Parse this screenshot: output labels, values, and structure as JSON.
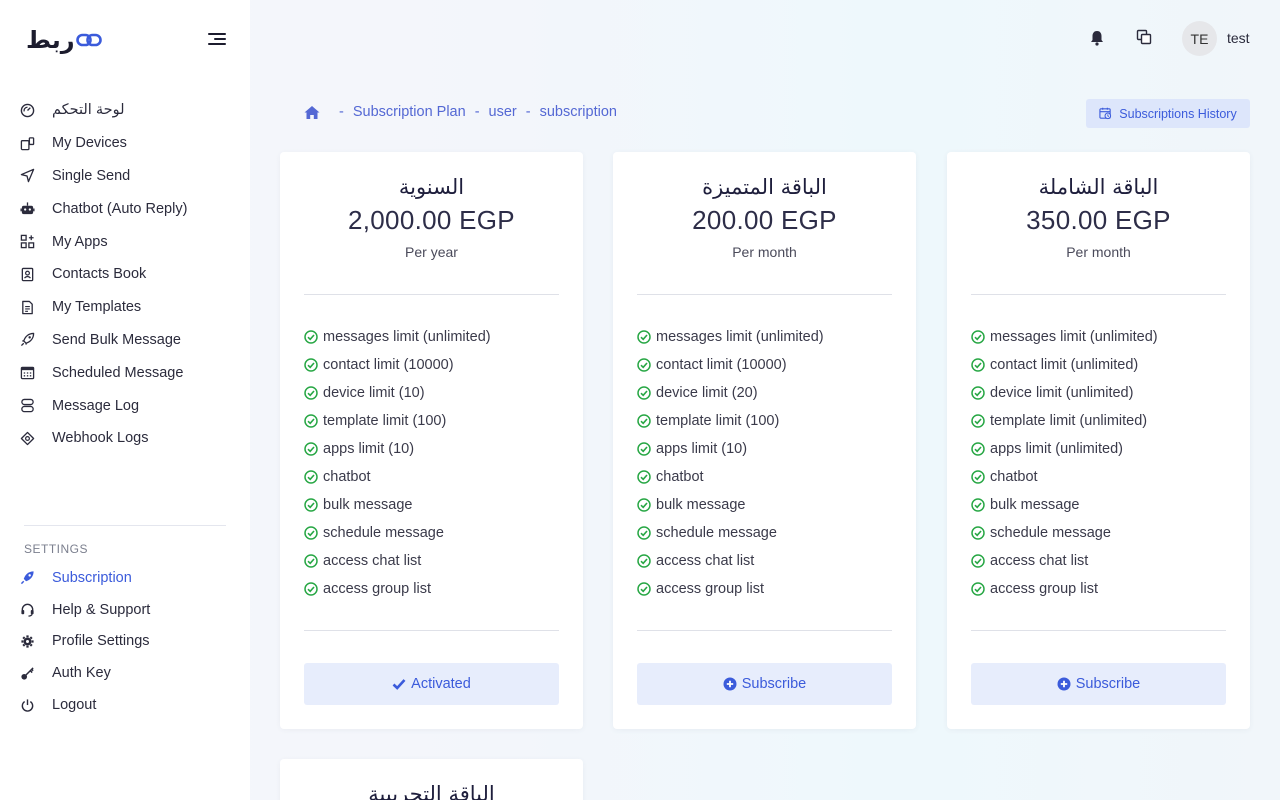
{
  "brand": {
    "logo_text": "ربط"
  },
  "sidebar": {
    "items": [
      {
        "label": "لوحة التحكم",
        "icon": "dashboard-icon"
      },
      {
        "label": "My Devices",
        "icon": "devices-icon"
      },
      {
        "label": "Single Send",
        "icon": "send-icon"
      },
      {
        "label": "Chatbot (Auto Reply)",
        "icon": "robot-icon"
      },
      {
        "label": "My Apps",
        "icon": "apps-icon"
      },
      {
        "label": "Contacts Book",
        "icon": "contacts-icon"
      },
      {
        "label": "My Templates",
        "icon": "templates-icon"
      },
      {
        "label": "Send Bulk Message",
        "icon": "rocket-icon"
      },
      {
        "label": "Scheduled Message",
        "icon": "calendar-icon"
      },
      {
        "label": "Message Log",
        "icon": "log-icon"
      },
      {
        "label": "Webhook Logs",
        "icon": "webhook-icon"
      }
    ],
    "settings_label": "SETTINGS",
    "settings_items": [
      {
        "label": "Subscription",
        "icon": "rocket-icon",
        "active": true
      },
      {
        "label": "Help & Support",
        "icon": "headset-icon"
      },
      {
        "label": "Profile Settings",
        "icon": "gear-icon"
      },
      {
        "label": "Auth Key",
        "icon": "key-icon"
      },
      {
        "label": "Logout",
        "icon": "power-icon"
      }
    ]
  },
  "header": {
    "avatar_initials": "TE",
    "username": "test"
  },
  "breadcrumb": {
    "items": [
      "Subscription Plan",
      "user",
      "subscription"
    ],
    "separator": "-"
  },
  "history_button": "Subscriptions History",
  "plans": [
    {
      "title": "السنوية",
      "price": "2,000.00 EGP",
      "period": "Per year",
      "features": [
        "messages limit (unlimited)",
        "contact limit (10000)",
        "device limit (10)",
        "template limit (100)",
        "apps limit (10)",
        "chatbot",
        "bulk message",
        "schedule message",
        "access chat list",
        "access group list"
      ],
      "button": "Activated",
      "button_icon": "check-icon"
    },
    {
      "title": "الباقة المتميزة",
      "price": "200.00 EGP",
      "period": "Per month",
      "features": [
        "messages limit (unlimited)",
        "contact limit (10000)",
        "device limit (20)",
        "template limit (100)",
        "apps limit (10)",
        "chatbot",
        "bulk message",
        "schedule message",
        "access chat list",
        "access group list"
      ],
      "button": "Subscribe",
      "button_icon": "plus-circle-icon"
    },
    {
      "title": "الباقة الشاملة",
      "price": "350.00 EGP",
      "period": "Per month",
      "features": [
        "messages limit (unlimited)",
        "contact limit (unlimited)",
        "device limit (unlimited)",
        "template limit (unlimited)",
        "apps limit (unlimited)",
        "chatbot",
        "bulk message",
        "schedule message",
        "access chat list",
        "access group list"
      ],
      "button": "Subscribe",
      "button_icon": "plus-circle-icon"
    },
    {
      "title": "الباقة التجريبية"
    }
  ],
  "colors": {
    "accent": "#3b5bdb",
    "check": "#28a745",
    "button_bg": "#e7edfc"
  }
}
